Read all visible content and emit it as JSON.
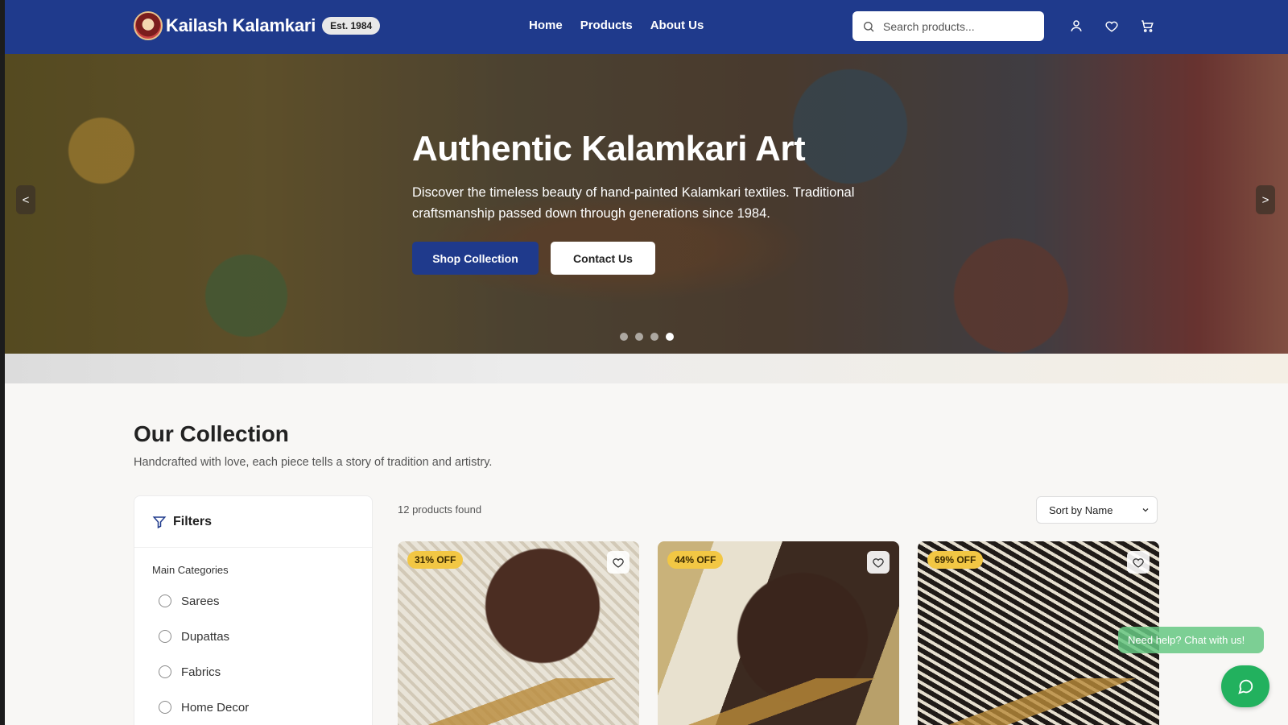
{
  "header": {
    "brand": "Kailash Kalamkari",
    "est_badge": "Est. 1984",
    "nav": [
      "Home",
      "Products",
      "About Us"
    ],
    "search_placeholder": "Search products..."
  },
  "hero": {
    "title": "Authentic Kalamkari Art",
    "subtitle": "Discover the timeless beauty of hand-painted Kalamkari textiles. Traditional craftsmanship passed down through generations since 1984.",
    "primary_button": "Shop Collection",
    "secondary_button": "Contact Us",
    "prev_label": "<",
    "next_label": ">",
    "slide_count": 4,
    "active_slide": 4
  },
  "collection": {
    "title": "Our Collection",
    "subtitle": "Handcrafted with love, each piece tells a story of tradition and artistry.",
    "products_found": "12 products found",
    "sort": "Sort by Name"
  },
  "filters": {
    "title": "Filters",
    "main_categories_label": "Main Categories",
    "categories": [
      "Sarees",
      "Dupattas",
      "Fabrics",
      "Home Decor"
    ]
  },
  "products": [
    {
      "discount": "31% OFF"
    },
    {
      "discount": "44% OFF"
    },
    {
      "discount": "69% OFF"
    }
  ],
  "chat": {
    "hint": "Need help? Chat with us!"
  },
  "colors": {
    "primary": "#1f3a8c",
    "discount_badge": "#f2c744",
    "chat": "#22b15e"
  }
}
